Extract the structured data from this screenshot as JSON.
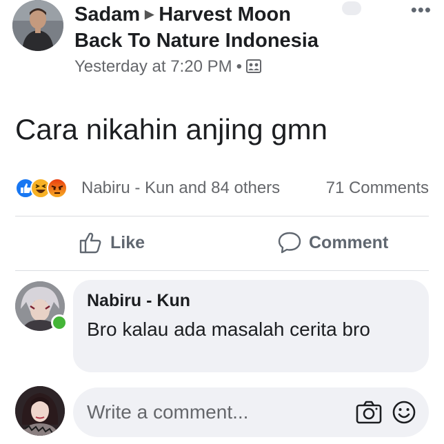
{
  "post": {
    "author": "Sadam",
    "group_line1": "Harvest Moon",
    "group_line2": "Back To Nature Indonesia",
    "timestamp": "Yesterday at 7:20 PM",
    "separator": "•",
    "audience_icon": "group-icon",
    "text": "Cara nikahin anjing gmn"
  },
  "reactions": {
    "icons": [
      "like-reaction-icon",
      "haha-reaction-icon",
      "angry-reaction-icon"
    ],
    "names": "Nabiru - Kun and 84 others",
    "comment_count": "71 Comments"
  },
  "actions": {
    "like_label": "Like",
    "comment_label": "Comment"
  },
  "comment": {
    "author": "Nabiru - Kun",
    "text": "Bro kalau ada masalah cerita bro",
    "online": true
  },
  "composer": {
    "placeholder": "Write a comment...",
    "icons": [
      "camera-icon",
      "smiley-icon"
    ]
  },
  "colors": {
    "like_blue": "#1877f2",
    "reaction_yellow": "#f7b125",
    "angry_orange": "#e9710f",
    "online_green": "#44b537",
    "secondary_text": "#65676b",
    "bubble_bg": "#f0f1f5"
  }
}
